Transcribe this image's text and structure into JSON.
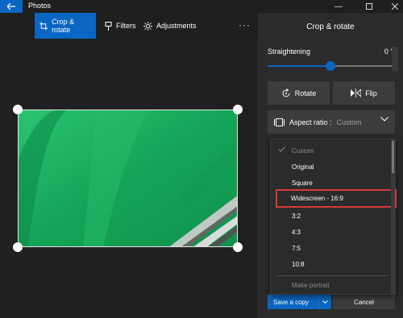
{
  "window": {
    "title": "Photos",
    "back_icon": "back-arrow-icon",
    "controls": [
      "minimize-icon",
      "maximize-icon",
      "close-icon"
    ]
  },
  "toolbar": {
    "crop_rotate_label": "Crop & rotate",
    "filters_label": "Filters",
    "adjustments_label": "Adjustments",
    "more_label": "···"
  },
  "panel": {
    "title": "Crop & rotate",
    "straightening_label": "Straightening",
    "straightening_value": "0 °",
    "straightening_level": 0.5,
    "rotate_label": "Rotate",
    "flip_label": "Flip",
    "aspect_label": "Aspect ratio :",
    "aspect_current": "Custom",
    "save_label": "Save a copy",
    "cancel_label": "Cancel"
  },
  "dropdown": {
    "options": [
      "Custom",
      "Original",
      "Square",
      "Widescreen - 16:9",
      "3:2",
      "4:3",
      "7:5",
      "10:8"
    ],
    "selected": "Custom",
    "highlighted": "Widescreen - 16:9",
    "make_portrait_label": "Make portrait"
  },
  "colors": {
    "accent": "#0a66c2",
    "panel_bg": "#2b2b2b",
    "canvas_bg": "#202020",
    "highlight_border": "#d63a3a",
    "photo_green": "#1fb35e"
  }
}
